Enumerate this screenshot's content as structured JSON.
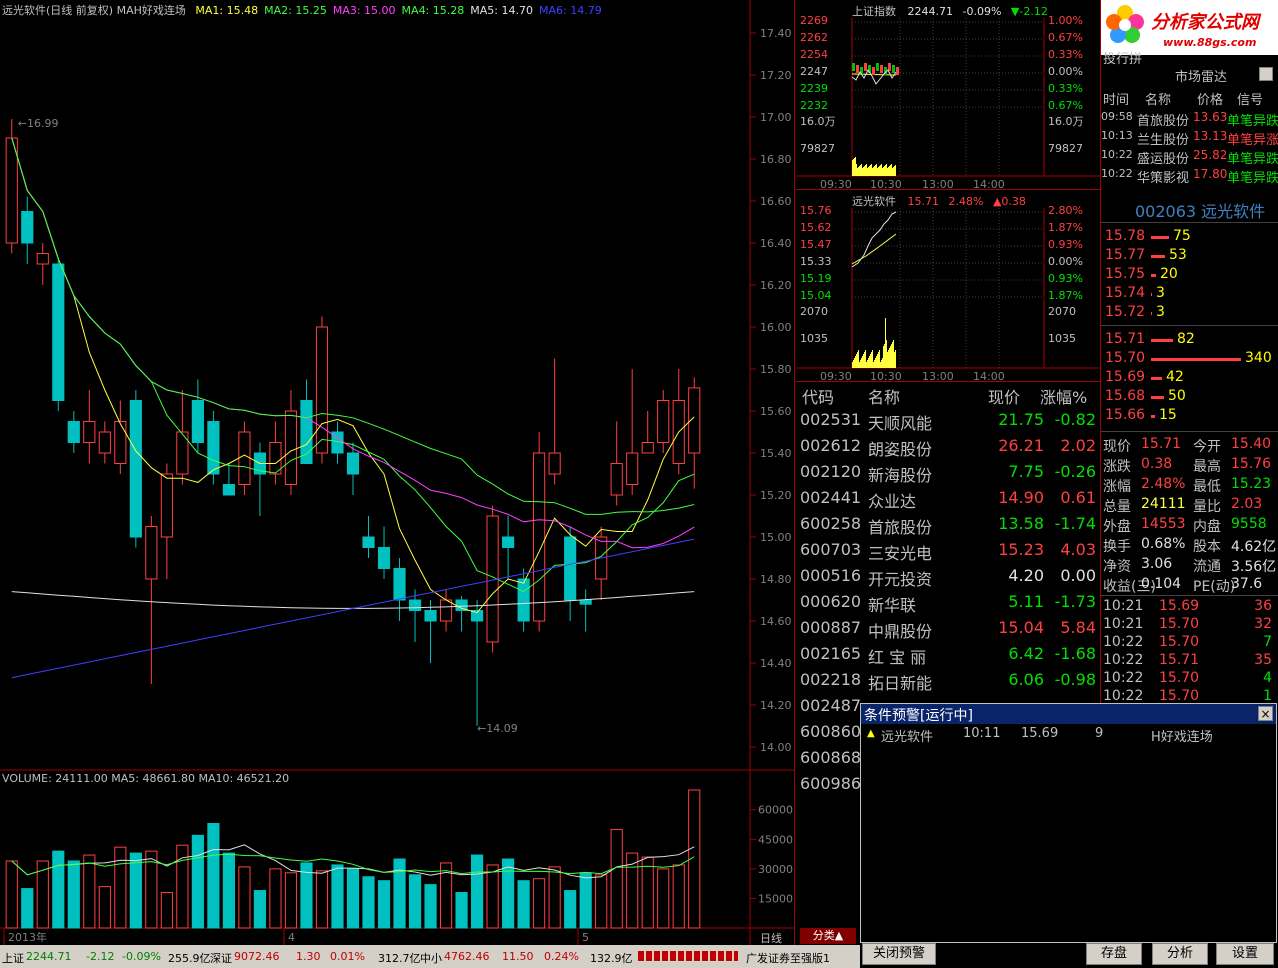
{
  "kline": {
    "title": "远光软件(日线 前复权)",
    "indicator": "MAH好戏连场",
    "ma": [
      {
        "label": "MA1: 15.48",
        "color": "#ffff40"
      },
      {
        "label": "MA2: 15.25",
        "color": "#40ff40"
      },
      {
        "label": "MA3: 15.00",
        "color": "#ff40ff"
      },
      {
        "label": "MA4: 15.28",
        "color": "#40ff40"
      },
      {
        "label": "MA5: 14.70",
        "color": "#e0e0e0"
      },
      {
        "label": "MA6: 14.79",
        "color": "#4040ff"
      }
    ],
    "price_axis": [
      "17.40",
      "17.20",
      "17.00",
      "16.80",
      "16.60",
      "16.40",
      "16.20",
      "16.00",
      "15.80",
      "15.60",
      "15.40",
      "15.20",
      "15.00",
      "14.80",
      "14.60",
      "14.40",
      "14.20",
      "14.00"
    ],
    "high_mark": "16.99",
    "low_mark": "14.09",
    "volume_title": "VOLUME: 24111.00  MA5: 48661.80  MA10: 46521.20",
    "volume_axis": [
      "60000",
      "45000",
      "30000",
      "15000"
    ],
    "date_labels": [
      "2013年",
      "4",
      "5"
    ],
    "unit_label": "日线"
  },
  "chart_data": {
    "type": "candlestick",
    "candles": [
      {
        "o": 16.4,
        "c": 16.9,
        "h": 16.99,
        "l": 16.35
      },
      {
        "o": 16.55,
        "c": 16.4,
        "h": 16.62,
        "l": 16.3
      },
      {
        "o": 16.3,
        "c": 16.35,
        "h": 16.4,
        "l": 16.2
      },
      {
        "o": 16.3,
        "c": 15.65,
        "h": 16.32,
        "l": 15.6
      },
      {
        "o": 15.55,
        "c": 15.45,
        "h": 15.6,
        "l": 15.4
      },
      {
        "o": 15.45,
        "c": 15.55,
        "h": 15.7,
        "l": 15.35
      },
      {
        "o": 15.4,
        "c": 15.5,
        "h": 15.55,
        "l": 15.35
      },
      {
        "o": 15.35,
        "c": 15.55,
        "h": 15.65,
        "l": 15.3
      },
      {
        "o": 15.65,
        "c": 15.0,
        "h": 15.7,
        "l": 14.95
      },
      {
        "o": 14.8,
        "c": 15.05,
        "h": 15.1,
        "l": 14.3
      },
      {
        "o": 15.0,
        "c": 15.3,
        "h": 15.35,
        "l": 14.8
      },
      {
        "o": 15.3,
        "c": 15.5,
        "h": 15.7,
        "l": 15.25
      },
      {
        "o": 15.65,
        "c": 15.45,
        "h": 15.75,
        "l": 15.4
      },
      {
        "o": 15.55,
        "c": 15.3,
        "h": 15.6,
        "l": 15.25
      },
      {
        "o": 15.25,
        "c": 15.2,
        "h": 15.35,
        "l": 15.2
      },
      {
        "o": 15.25,
        "c": 15.5,
        "h": 15.55,
        "l": 15.2
      },
      {
        "o": 15.4,
        "c": 15.3,
        "h": 15.45,
        "l": 15.1
      },
      {
        "o": 15.3,
        "c": 15.45,
        "h": 15.55,
        "l": 15.25
      },
      {
        "o": 15.25,
        "c": 15.6,
        "h": 15.7,
        "l": 15.2
      },
      {
        "o": 15.65,
        "c": 15.35,
        "h": 15.75,
        "l": 15.35
      },
      {
        "o": 15.4,
        "c": 16.0,
        "h": 16.05,
        "l": 15.35
      },
      {
        "o": 15.5,
        "c": 15.4,
        "h": 15.55,
        "l": 15.35
      },
      {
        "o": 15.4,
        "c": 15.3,
        "h": 15.45,
        "l": 15.2
      },
      {
        "o": 15.0,
        "c": 14.95,
        "h": 15.1,
        "l": 14.9
      },
      {
        "o": 14.95,
        "c": 14.85,
        "h": 15.05,
        "l": 14.8
      },
      {
        "o": 14.85,
        "c": 14.7,
        "h": 14.9,
        "l": 14.6
      },
      {
        "o": 14.7,
        "c": 14.65,
        "h": 14.75,
        "l": 14.5
      },
      {
        "o": 14.65,
        "c": 14.6,
        "h": 14.7,
        "l": 14.4
      },
      {
        "o": 14.6,
        "c": 14.7,
        "h": 14.75,
        "l": 14.55
      },
      {
        "o": 14.7,
        "c": 14.65,
        "h": 14.72,
        "l": 14.55
      },
      {
        "o": 14.65,
        "c": 14.6,
        "h": 14.7,
        "l": 14.1
      },
      {
        "o": 14.5,
        "c": 15.1,
        "h": 15.15,
        "l": 14.45
      },
      {
        "o": 15.0,
        "c": 14.95,
        "h": 15.1,
        "l": 14.8
      },
      {
        "o": 14.8,
        "c": 14.6,
        "h": 14.85,
        "l": 14.55
      },
      {
        "o": 14.6,
        "c": 15.4,
        "h": 15.5,
        "l": 14.55
      },
      {
        "o": 15.3,
        "c": 15.4,
        "h": 15.85,
        "l": 15.25
      },
      {
        "o": 15.0,
        "c": 14.7,
        "h": 15.05,
        "l": 14.6
      },
      {
        "o": 14.7,
        "c": 14.68,
        "h": 14.75,
        "l": 14.55
      },
      {
        "o": 14.8,
        "c": 15.0,
        "h": 15.05,
        "l": 14.7
      },
      {
        "o": 15.2,
        "c": 15.35,
        "h": 15.55,
        "l": 15.15
      },
      {
        "o": 15.25,
        "c": 15.4,
        "h": 15.8,
        "l": 15.2
      },
      {
        "o": 15.4,
        "c": 15.45,
        "h": 15.6,
        "l": 15.4
      },
      {
        "o": 15.45,
        "c": 15.65,
        "h": 15.7,
        "l": 15.4
      },
      {
        "o": 15.35,
        "c": 15.65,
        "h": 15.8,
        "l": 15.3
      },
      {
        "o": 15.4,
        "c": 15.71,
        "h": 15.76,
        "l": 15.23
      }
    ],
    "volumes": [
      34000,
      20000,
      34000,
      39000,
      34000,
      37000,
      21000,
      41000,
      38000,
      39000,
      18000,
      42000,
      47000,
      53000,
      38000,
      31000,
      19000,
      30000,
      28000,
      33000,
      29000,
      32000,
      30000,
      26000,
      24000,
      35000,
      27000,
      22000,
      33000,
      18000,
      37000,
      32000,
      35000,
      24000,
      25000,
      31000,
      19000,
      28000,
      27000,
      50000,
      38000,
      36000,
      30000,
      32000,
      70000
    ],
    "ylim": [
      13.9,
      17.5
    ],
    "vlim": [
      0,
      70000
    ]
  },
  "index_mini": {
    "title": "上证指数",
    "price": "2244.71",
    "pct": "-0.09%",
    "chg": "▼-2.12",
    "left": [
      "2269",
      "2262",
      "2254",
      "2247",
      "2239",
      "2232",
      "16.0万",
      "79827"
    ],
    "right": [
      "1.00%",
      "0.67%",
      "0.33%",
      "0.00%",
      "0.33%",
      "0.67%",
      "16.0万",
      "79827"
    ],
    "times": [
      "09:30",
      "10:30",
      "13:00",
      "14:00"
    ]
  },
  "stock_mini": {
    "title": "远光软件",
    "price": "15.71",
    "pct": "2.48%",
    "chg": "▲0.38",
    "left": [
      "15.76",
      "15.62",
      "15.47",
      "15.33",
      "15.19",
      "15.04",
      "2070",
      "1035"
    ],
    "right": [
      "2.80%",
      "1.87%",
      "0.93%",
      "0.00%",
      "0.93%",
      "1.87%",
      "2070",
      "1035"
    ],
    "times": [
      "09:30",
      "10:30",
      "13:00",
      "14:00"
    ]
  },
  "stock_list": {
    "headers": [
      "代码",
      "名称",
      "现价",
      "涨幅%"
    ],
    "rows": [
      {
        "code": "002531",
        "name": "天顺风能",
        "price": "21.75",
        "pct": "-0.82",
        "up": false
      },
      {
        "code": "002612",
        "name": "朗姿股份",
        "price": "26.21",
        "pct": "2.02",
        "up": true
      },
      {
        "code": "002120",
        "name": "新海股份",
        "price": "7.75",
        "pct": "-0.26",
        "up": false
      },
      {
        "code": "002441",
        "name": "众业达",
        "price": "14.90",
        "pct": "0.61",
        "up": true
      },
      {
        "code": "600258",
        "name": "首旅股份",
        "price": "13.58",
        "pct": "-1.74",
        "up": false
      },
      {
        "code": "600703",
        "name": "三安光电",
        "price": "15.23",
        "pct": "4.03",
        "up": true
      },
      {
        "code": "000516",
        "name": "开元投资",
        "price": "4.20",
        "pct": "0.00",
        "up": null
      },
      {
        "code": "000620",
        "name": "新华联",
        "price": "5.11",
        "pct": "-1.73",
        "up": false
      },
      {
        "code": "000887",
        "name": "中鼎股份",
        "price": "15.04",
        "pct": "5.84",
        "up": true
      },
      {
        "code": "002165",
        "name": "红 宝 丽",
        "price": "6.42",
        "pct": "-1.68",
        "up": false
      },
      {
        "code": "002218",
        "name": "拓日新能",
        "price": "6.06",
        "pct": "-0.98",
        "up": false
      },
      {
        "code": "002487",
        "name": "",
        "price": "",
        "pct": "",
        "up": null
      },
      {
        "code": "600860",
        "name": "",
        "price": "",
        "pct": "",
        "up": null
      },
      {
        "code": "600868",
        "name": "",
        "price": "",
        "pct": "",
        "up": null
      },
      {
        "code": "600986",
        "name": "",
        "price": "",
        "pct": "",
        "up": null
      }
    ],
    "category_tab": "分类▲"
  },
  "radar": {
    "logo_text": "分析家公式网",
    "logo_url": "www.88gs.com",
    "title": "市场雷达",
    "cut_label": "投行拼",
    "headers": [
      "时间",
      "名称",
      "价格",
      "信号"
    ],
    "rows": [
      {
        "time": "09:58",
        "name": "首旅股份",
        "price": "13.63",
        "signal": "单笔异跌",
        "up": false
      },
      {
        "time": "10:13",
        "name": "兰生股份",
        "price": "13.13",
        "signal": "单笔异涨",
        "up": true
      },
      {
        "time": "10:22",
        "name": "盛运股份",
        "price": "25.82",
        "signal": "单笔异跌",
        "up": false
      },
      {
        "time": "10:22",
        "name": "华策影视",
        "price": "17.80",
        "signal": "单笔异跌",
        "up": false
      }
    ]
  },
  "quote": {
    "code_name": "002063 远光软件",
    "asks": [
      {
        "p": "15.78",
        "v": "75",
        "w": 18
      },
      {
        "p": "15.77",
        "v": "53",
        "w": 14
      },
      {
        "p": "15.75",
        "v": "20",
        "w": 5
      },
      {
        "p": "15.74",
        "v": "3",
        "w": 1
      },
      {
        "p": "15.72",
        "v": "3",
        "w": 1
      }
    ],
    "bids": [
      {
        "p": "15.71",
        "v": "82",
        "w": 22
      },
      {
        "p": "15.70",
        "v": "340",
        "w": 90
      },
      {
        "p": "15.69",
        "v": "42",
        "w": 11
      },
      {
        "p": "15.68",
        "v": "50",
        "w": 13
      },
      {
        "p": "15.66",
        "v": "15",
        "w": 4
      }
    ],
    "stats": [
      {
        "l1": "现价",
        "v1": "15.71",
        "c1": "red",
        "l2": "今开",
        "v2": "15.40",
        "c2": "red"
      },
      {
        "l1": "涨跌",
        "v1": "0.38",
        "c1": "red",
        "l2": "最高",
        "v2": "15.76",
        "c2": "red"
      },
      {
        "l1": "涨幅",
        "v1": "2.48%",
        "c1": "red",
        "l2": "最低",
        "v2": "15.23",
        "c2": "grn"
      },
      {
        "l1": "总量",
        "v1": "24111",
        "c1": "yel",
        "l2": "量比",
        "v2": "2.03",
        "c2": "red"
      },
      {
        "l1": "外盘",
        "v1": "14553",
        "c1": "red",
        "l2": "内盘",
        "v2": "9558",
        "c2": "grn"
      },
      {
        "l1": "换手",
        "v1": "0.68%",
        "c1": "wht",
        "l2": "股本",
        "v2": "4.62亿",
        "c2": "wht"
      },
      {
        "l1": "净资",
        "v1": "3.06",
        "c1": "wht",
        "l2": "流通",
        "v2": "3.56亿",
        "c2": "wht"
      },
      {
        "l1": "收益(三)",
        "v1": "0.104",
        "c1": "wht",
        "l2": "PE(动)",
        "v2": "37.6",
        "c2": "wht"
      }
    ],
    "ticks": [
      {
        "t": "10:21",
        "p": "15.69",
        "v": "36",
        "up": true
      },
      {
        "t": "10:21",
        "p": "15.70",
        "v": "32",
        "up": true
      },
      {
        "t": "10:22",
        "p": "15.70",
        "v": "7",
        "up": false
      },
      {
        "t": "10:22",
        "p": "15.71",
        "v": "35",
        "up": true
      },
      {
        "t": "10:22",
        "p": "15.70",
        "v": "4",
        "up": false
      },
      {
        "t": "10:22",
        "p": "15.70",
        "v": "1",
        "up": false
      }
    ]
  },
  "alert": {
    "title": "条件预警[运行中]",
    "close": "×",
    "row": {
      "name": "远光软件",
      "time": "10:11",
      "price": "15.69",
      "count": "9",
      "formula": "H好戏连场"
    }
  },
  "buttons": {
    "close_alert": "关闭预警",
    "save": "存盘",
    "analyze": "分析",
    "settings": "设置"
  },
  "status": {
    "sh_label": "上证",
    "sh_value": "2244.71",
    "sh_chg": "-2.12",
    "sh_pct": "-0.09%",
    "sh_amt": "255.9亿",
    "sz_label": "深证",
    "sz_value": "9072.46",
    "sz_chg": "1.30",
    "sz_pct": "0.01%",
    "sz_amt": "312.7亿",
    "zx_label": "中小",
    "zx_value": "4762.46",
    "zx_chg": "11.50",
    "zx_pct": "0.24%",
    "zx_amt": "132.9亿",
    "broker": "广发证券至强版1"
  }
}
